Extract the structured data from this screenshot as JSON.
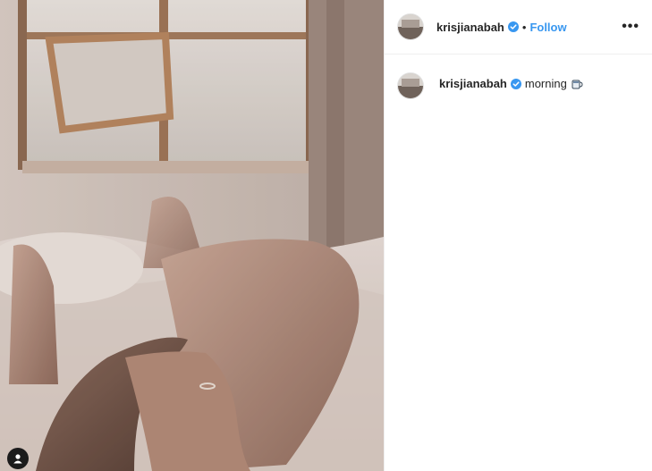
{
  "post": {
    "username": "krisjianabah",
    "follow_label": "Follow",
    "separator": "•",
    "more_label": "•••"
  },
  "caption": {
    "username": "krisjianabah",
    "text": "morning",
    "emoji_icon": "coffee-cup-icon"
  },
  "colors": {
    "link": "#3897f0",
    "text": "#262626",
    "verified": "#3897f0"
  }
}
